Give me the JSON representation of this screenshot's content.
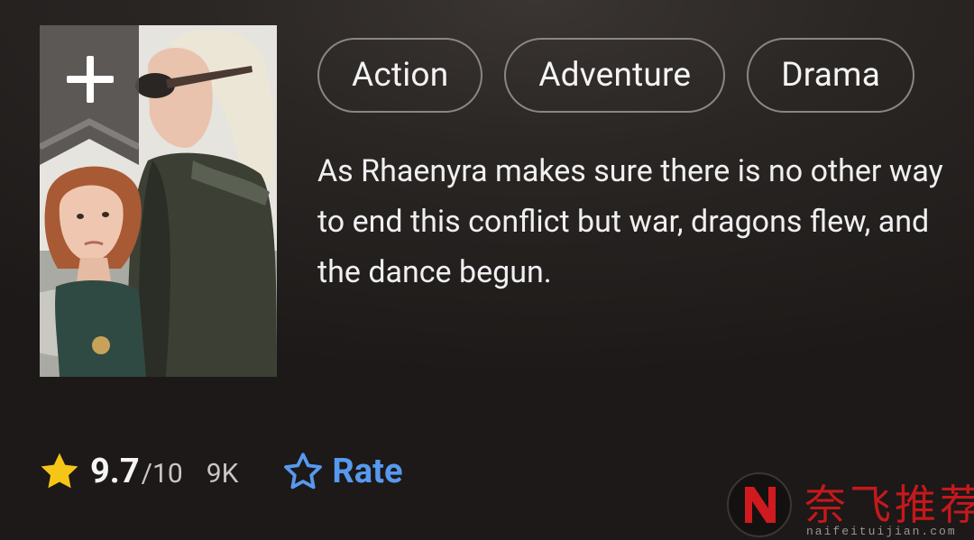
{
  "poster": {
    "alt": "Show poster"
  },
  "watchlist": {
    "icon": "plus-icon"
  },
  "genres": [
    {
      "label": "Action"
    },
    {
      "label": "Adventure"
    },
    {
      "label": "Drama"
    }
  ],
  "description": "As Rhaenyra makes sure there is no other way to end this conflict but war, dragons flew, and the dance begun.",
  "rating": {
    "value": "9.7",
    "scale": "/10",
    "count": "9K",
    "star_color": "#f5c518"
  },
  "rate": {
    "label": "Rate",
    "color": "#5799ef"
  },
  "watermark": {
    "logo_letter": "N",
    "text": "奈飞推荐",
    "url": "naifeituijian.com"
  }
}
